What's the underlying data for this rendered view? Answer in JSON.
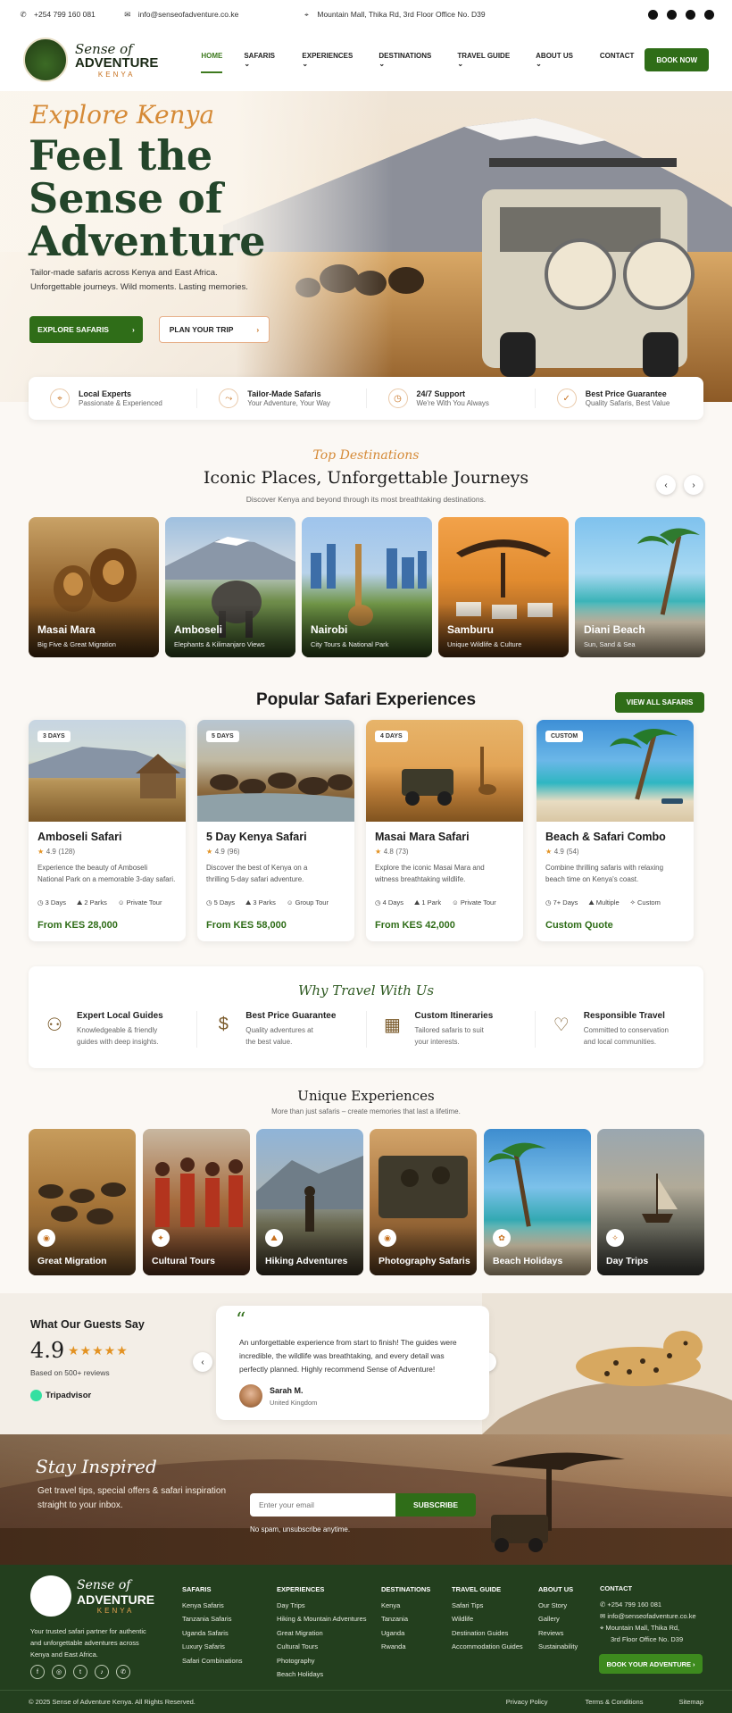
{
  "topbar": {
    "phone": "+254 799 160 081",
    "email": "info@senseofadventure.co.ke",
    "address": "Mountain Mall, Thika Rd, 3rd Floor Office No. D39",
    "socials": [
      "facebook-icon",
      "instagram-icon",
      "twitter-icon",
      "whatsapp-icon"
    ]
  },
  "logo": {
    "line1": "Sense of",
    "line2": "ADVENTURE",
    "line3": "KENYA"
  },
  "nav": {
    "items": [
      {
        "label": "HOME"
      },
      {
        "label": "SAFARIS"
      },
      {
        "label": "EXPERIENCES"
      },
      {
        "label": "DESTINATIONS"
      },
      {
        "label": "TRAVEL GUIDE"
      },
      {
        "label": "ABOUT US"
      },
      {
        "label": "CONTACT"
      }
    ],
    "book_now": "BOOK NOW"
  },
  "hero": {
    "kicker": "Explore Kenya",
    "title_l1": "Feel the",
    "title_l2": "Sense of",
    "title_l3": "Adventure",
    "subtitle_l1": "Tailor-made safaris across Kenya and East Africa.",
    "subtitle_l2": "Unforgettable journeys. Wild moments. Lasting memories.",
    "cta_primary": "EXPLORE SAFARIS",
    "cta_secondary": "PLAN YOUR TRIP"
  },
  "features": [
    {
      "title": "Local Experts",
      "sub": "Passionate & Experienced"
    },
    {
      "title": "Tailor-Made Safaris",
      "sub": "Your Adventure, Your Way"
    },
    {
      "title": "24/7 Support",
      "sub": "We're With You Always"
    },
    {
      "title": "Best Price Guarantee",
      "sub": "Quality Safaris, Best Value"
    }
  ],
  "destinations": {
    "kicker": "Top Destinations",
    "title": "Iconic Places, Unforgettable Journeys",
    "subtitle": "Discover Kenya and beyond through its most breathtaking destinations.",
    "items": [
      {
        "name": "Masai Mara",
        "sub": "Big Five & Great Migration"
      },
      {
        "name": "Amboseli",
        "sub": "Elephants & Kilimanjaro Views"
      },
      {
        "name": "Nairobi",
        "sub": "City Tours & National Park"
      },
      {
        "name": "Samburu",
        "sub": "Unique Wildlife & Culture"
      },
      {
        "name": "Diani Beach",
        "sub": "Sun, Sand & Sea"
      }
    ]
  },
  "safaris": {
    "title": "Popular Safari Experiences",
    "view_all": "VIEW ALL SAFARIS",
    "items": [
      {
        "badge": "3 DAYS",
        "name": "Amboseli Safari",
        "rating": "4.9",
        "count": "(128)",
        "desc_l1": "Experience the beauty of Amboseli",
        "desc_l2": "National Park on a memorable 3-day safari.",
        "m1": "3 Days",
        "m2": "2 Parks",
        "m3": "Private Tour",
        "price": "From KES 28,000"
      },
      {
        "badge": "5 DAYS",
        "name": "5 Day Kenya Safari",
        "rating": "4.9",
        "count": "(96)",
        "desc_l1": "Discover the best of Kenya on a",
        "desc_l2": "thrilling 5-day safari adventure.",
        "m1": "5 Days",
        "m2": "3 Parks",
        "m3": "Group Tour",
        "price": "From KES 58,000"
      },
      {
        "badge": "4 DAYS",
        "name": "Masai Mara Safari",
        "rating": "4.8",
        "count": "(73)",
        "desc_l1": "Explore the iconic Masai Mara and",
        "desc_l2": "witness breathtaking wildlife.",
        "m1": "4 Days",
        "m2": "1 Park",
        "m3": "Private Tour",
        "price": "From KES 42,000"
      },
      {
        "badge": "CUSTOM",
        "name": "Beach & Safari Combo",
        "rating": "4.9",
        "count": "(54)",
        "desc_l1": "Combine thrilling safaris with relaxing",
        "desc_l2": "beach time on Kenya's coast.",
        "m1": "7+ Days",
        "m2": "Multiple",
        "m3": "Custom",
        "price": "Custom Quote"
      }
    ]
  },
  "why": {
    "title": "Why Travel With Us",
    "items": [
      {
        "title": "Expert Local Guides",
        "l1": "Knowledgeable & friendly",
        "l2": "guides with deep insights."
      },
      {
        "title": "Best Price Guarantee",
        "l1": "Quality adventures at",
        "l2": "the best value."
      },
      {
        "title": "Custom Itineraries",
        "l1": "Tailored safaris to suit",
        "l2": "your interests."
      },
      {
        "title": "Responsible Travel",
        "l1": "Committed to conservation",
        "l2": "and local communities."
      }
    ]
  },
  "unique": {
    "title": "Unique Experiences",
    "subtitle": "More than just safaris – create memories that last a lifetime.",
    "items": [
      {
        "name": "Great Migration"
      },
      {
        "name": "Cultural Tours"
      },
      {
        "name": "Hiking Adventures"
      },
      {
        "name": "Photography Safaris"
      },
      {
        "name": "Beach Holidays"
      },
      {
        "name": "Day Trips"
      }
    ]
  },
  "reviews": {
    "title": "What Our Guests Say",
    "score": "4.9",
    "stars": 5,
    "based": "Based on 500+ reviews",
    "platform": "Tripadvisor",
    "quote_l1": "An unforgettable experience from start to finish! The guides were",
    "quote_l2": "incredible, the wildlife was breathtaking, and every detail was",
    "quote_l3": "perfectly planned. Highly recommend Sense of Adventure!",
    "author": "Sarah M.",
    "country": "United Kingdom"
  },
  "newsletter": {
    "title": "Stay Inspired",
    "text_l1": "Get travel tips, special offers & safari inspiration",
    "text_l2": "straight to your inbox.",
    "placeholder": "Enter your email",
    "button": "SUBSCRIBE",
    "note": "No spam, unsubscribe anytime."
  },
  "footer": {
    "about_l1": "Your trusted safari partner for authentic",
    "about_l2": "and unforgettable adventures across",
    "about_l3": "Kenya and East Africa.",
    "cols": [
      {
        "title": "SAFARIS",
        "links": [
          "Kenya Safaris",
          "Tanzania Safaris",
          "Uganda Safaris",
          "Luxury Safaris",
          "Safari Combinations"
        ]
      },
      {
        "title": "EXPERIENCES",
        "links": [
          "Day Trips",
          "Hiking & Mountain Adventures",
          "Great Migration",
          "Cultural Tours",
          "Photography",
          "Beach Holidays"
        ]
      },
      {
        "title": "DESTINATIONS",
        "links": [
          "Kenya",
          "Tanzania",
          "Uganda",
          "Rwanda"
        ]
      },
      {
        "title": "TRAVEL GUIDE",
        "links": [
          "Safari Tips",
          "Wildlife",
          "Destination Guides",
          "Accommodation Guides"
        ]
      },
      {
        "title": "ABOUT US",
        "links": [
          "Our Story",
          "Gallery",
          "Reviews",
          "Sustainability"
        ]
      }
    ],
    "contact_title": "CONTACT",
    "contact_phone": "+254 799 160 081",
    "contact_email": "info@senseofadventure.co.ke",
    "contact_addr_l1": "Mountain Mall, Thika Rd,",
    "contact_addr_l2": "3rd Floor Office No. D39",
    "book_btn": "BOOK YOUR ADVENTURE",
    "copyright": "© 2025 Sense of Adventure Kenya. All Rights Reserved.",
    "legal": [
      "Privacy Policy",
      "Terms & Conditions",
      "Sitemap"
    ]
  },
  "colors": {
    "brand_green": "#2f6d18",
    "accent_orange": "#c7711f",
    "footer_green": "#233f1e"
  }
}
